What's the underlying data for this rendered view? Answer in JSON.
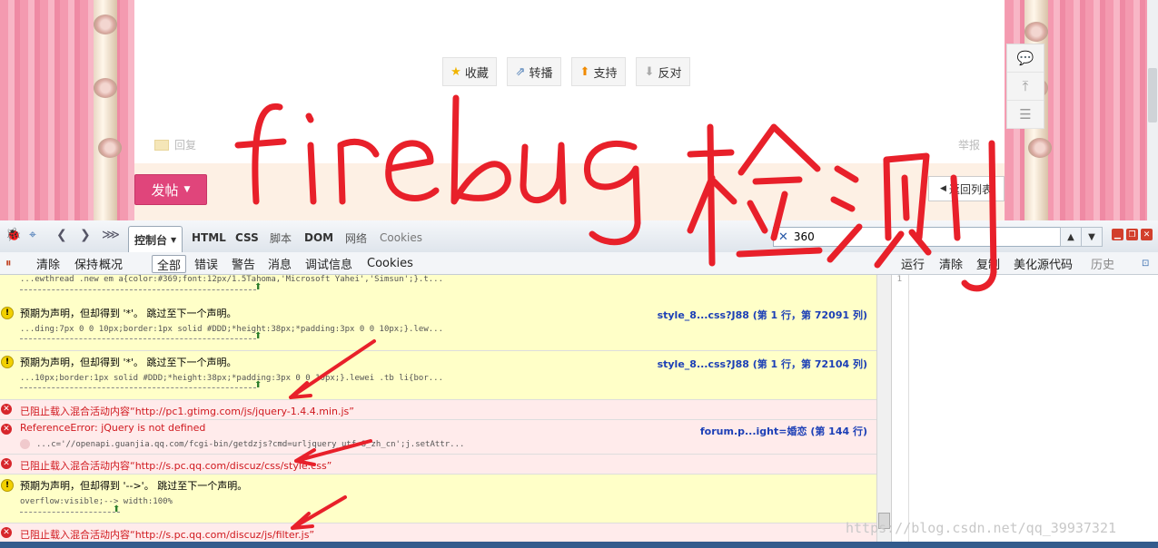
{
  "webpage": {
    "actions": [
      {
        "label": "收藏",
        "icon": "star-icon"
      },
      {
        "label": "转播",
        "icon": "share-icon"
      },
      {
        "label": "支持",
        "icon": "arrow-up-icon"
      },
      {
        "label": "反对",
        "icon": "arrow-down-icon"
      }
    ],
    "reply_label": "回复",
    "report_label": "举报",
    "post_button": "发帖",
    "back_to_list": "返回列表"
  },
  "firebug": {
    "tabs": [
      "控制台",
      "HTML",
      "CSS",
      "脚本",
      "DOM",
      "网络",
      "Cookies"
    ],
    "search_value": "360",
    "subbar_left": [
      "清除",
      "保持",
      "概况",
      "全部",
      "错误",
      "警告",
      "消息",
      "调试信息",
      "Cookies"
    ],
    "subbar_right": [
      "运行",
      "清除",
      "复制",
      "美化源代码",
      "历史"
    ],
    "gutter_line": "1"
  },
  "console": [
    {
      "type": "warn",
      "msg": "",
      "code": "...ewthread .new em a{color:#369;font:12px/1.5Tahoma,'Microsoft Yahei','Simsun';}.t...",
      "src": ""
    },
    {
      "type": "warn",
      "msg": "预期为声明，但却得到 '*'。 跳过至下一个声明。",
      "code": "...ding:7px 0 0 10px;border:1px solid #DDD;*height:38px;*padding:3px 0 0 10px;}.lew...",
      "src": "style_8...css?J88 (第 1 行，第 72091 列)"
    },
    {
      "type": "warn",
      "msg": "预期为声明，但却得到 '*'。 跳过至下一个声明。",
      "code": "...10px;border:1px solid #DDD;*height:38px;*padding:3px 0 0 10px;}.lewei .tb li{bor...",
      "src": "style_8...css?J88 (第 1 行，第 72104 列)"
    },
    {
      "type": "err",
      "msg": "已阻止载入混合活动内容“http://pc1.gtimg.com/js/jquery-1.4.4.min.js”",
      "code": "",
      "src": ""
    },
    {
      "type": "err",
      "msg": "ReferenceError: jQuery is not defined",
      "code": "...c='//openapi.guanjia.qq.com/fcgi-bin/getdzjs?cmd=urljquery_utf-8_zh_cn';j.setAttr...",
      "src": "forum.p...ight=婚恋 (第 144 行)"
    },
    {
      "type": "err",
      "msg": "已阻止载入混合活动内容“http://s.pc.qq.com/discuz/css/style.css”",
      "code": "",
      "src": ""
    },
    {
      "type": "warn",
      "msg": "预期为声明，但却得到 '-->'。 跳过至下一个声明。",
      "code": "overflow:visible;--> width:100%",
      "src": ""
    },
    {
      "type": "err",
      "msg": "已阻止载入混合活动内容“http://s.pc.qq.com/discuz/js/filter.js”",
      "code": "",
      "src": ""
    }
  ],
  "watermark": "https://blog.csdn.net/qq_39937321",
  "annotation_text": "firebug检测",
  "colors": {
    "annotation": "#e8202a",
    "error_text": "#d0191f",
    "warn_bg": "#ffffc8",
    "error_bg": "#ffebeb",
    "source_link": "#1c3fb6",
    "post_button": "#e0457b"
  }
}
